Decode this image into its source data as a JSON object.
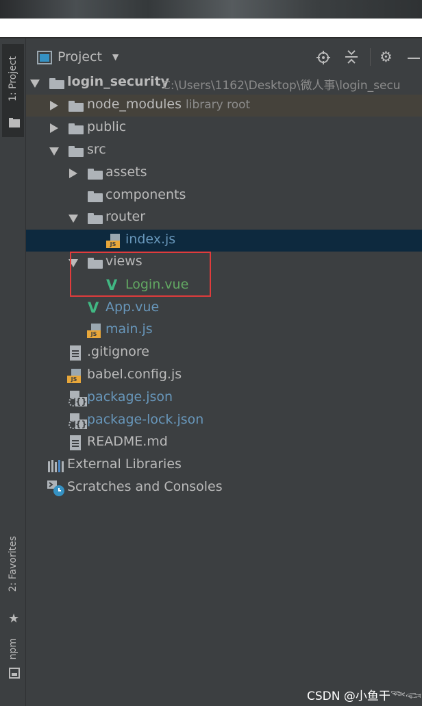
{
  "left_bar": {
    "project_tab": "1: Project",
    "favorites_tab": "2: Favorites",
    "npm_tab": "npm"
  },
  "toolbar": {
    "title": "Project",
    "dropdown_icon": "caret-down-icon",
    "locate_icon": "locate-icon",
    "collapse_icon": "collapse-all-icon",
    "settings_icon": "gear-icon",
    "hide_icon": "minimize-icon"
  },
  "tree": {
    "root": {
      "name": "login_security",
      "path": "C:\\Users\\1162\\Desktop\\微人事\\login_secu"
    },
    "node_modules": {
      "name": "node_modules",
      "hint": "library root"
    },
    "public": {
      "name": "public"
    },
    "src": {
      "name": "src"
    },
    "assets": {
      "name": "assets"
    },
    "components": {
      "name": "components"
    },
    "router": {
      "name": "router"
    },
    "index_js": {
      "name": "index.js"
    },
    "views": {
      "name": "views"
    },
    "login_vue": {
      "name": "Login.vue"
    },
    "app_vue": {
      "name": "App.vue"
    },
    "main_js": {
      "name": "main.js"
    },
    "gitignore": {
      "name": ".gitignore"
    },
    "babel_config": {
      "name": "babel.config.js"
    },
    "package_json": {
      "name": "package.json"
    },
    "package_lock": {
      "name": "package-lock.json"
    },
    "readme": {
      "name": "README.md"
    },
    "external_libraries": {
      "name": "External Libraries"
    },
    "scratches": {
      "name": "Scratches and Consoles"
    }
  },
  "colors": {
    "background": "#3c3f41",
    "selected_row": "#0d293e",
    "library_row": "#45423b",
    "text": "#bbbbbb",
    "vcs_blue": "#6897bb",
    "vcs_green": "#62a862",
    "highlight_box": "#e03c3c"
  },
  "watermark": "CSDN @小鱼干𓆝𓆟𓆜"
}
